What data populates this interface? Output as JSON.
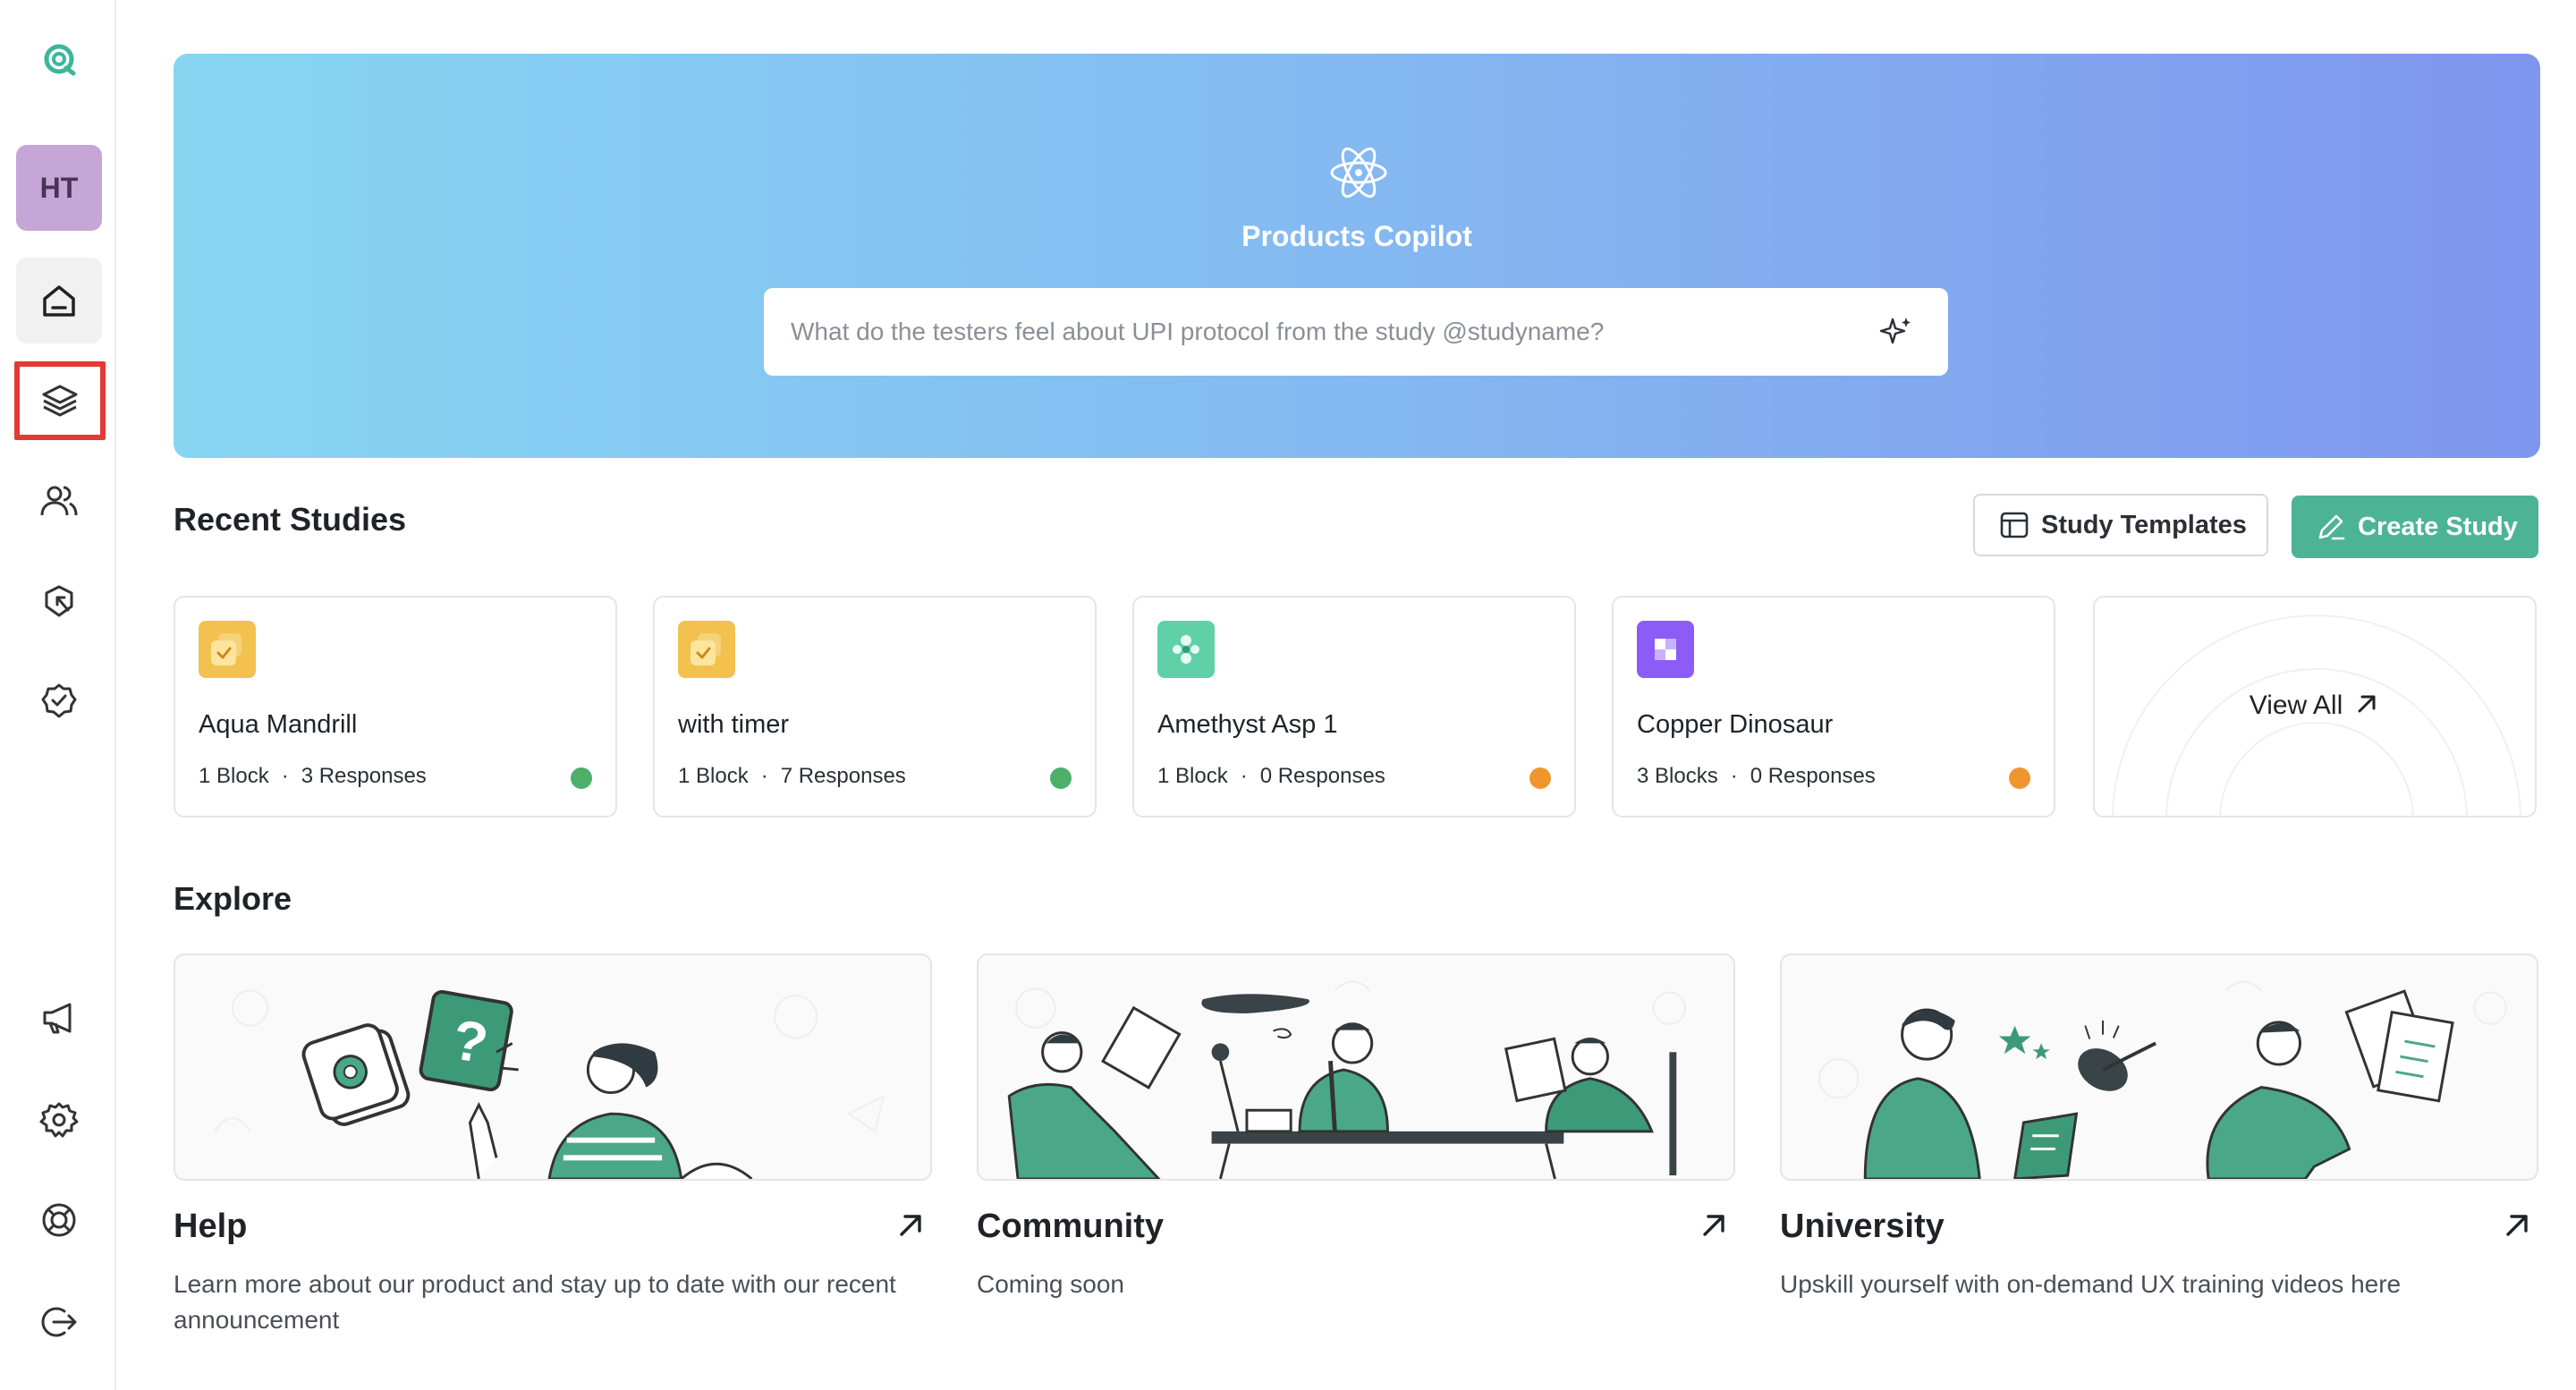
{
  "sidebar": {
    "avatar_initials": "HT",
    "items": [
      {
        "icon": "logo-icon"
      },
      {
        "icon": "home-icon"
      },
      {
        "icon": "layers-icon"
      },
      {
        "icon": "people-icon"
      },
      {
        "icon": "cursor-click-icon"
      },
      {
        "icon": "check-badge-icon"
      },
      {
        "icon": "megaphone-icon"
      },
      {
        "icon": "gear-icon"
      },
      {
        "icon": "lifebuoy-icon"
      },
      {
        "icon": "logout-icon"
      }
    ],
    "highlight_color": "#e53935"
  },
  "hero": {
    "title": "Products Copilot",
    "search_placeholder": "What do the testers feel about UPI protocol from the study @studyname?",
    "gradient": [
      "#86d6f2",
      "#7f96ee"
    ]
  },
  "recent": {
    "title": "Recent Studies",
    "templates_button": "Study Templates",
    "create_button": "Create Study",
    "studies": [
      {
        "name": "Aqua Mandrill",
        "blocks": "1 Block",
        "responses": "3 Responses",
        "status_color": "#4caf6a",
        "icon_color": "#f2c14e"
      },
      {
        "name": "with timer",
        "blocks": "1 Block",
        "responses": "7 Responses",
        "status_color": "#4caf6a",
        "icon_color": "#f2c14e"
      },
      {
        "name": "Amethyst Asp 1",
        "blocks": "1 Block",
        "responses": "0 Responses",
        "status_color": "#f0952e",
        "icon_color": "#5fd0a8"
      },
      {
        "name": "Copper Dinosaur",
        "blocks": "3 Blocks",
        "responses": "0 Responses",
        "status_color": "#f0952e",
        "icon_color": "#8b5cf6"
      }
    ],
    "view_all": "View All"
  },
  "explore": {
    "title": "Explore",
    "cards": [
      {
        "title": "Help",
        "description": "Learn more about our product and stay up to date with our recent announcement"
      },
      {
        "title": "Community",
        "description": "Coming soon"
      },
      {
        "title": "University",
        "description": "Upskill yourself with on-demand UX training videos here"
      }
    ]
  },
  "colors": {
    "accent": "#4cb494",
    "illustration_green": "#4aa888"
  }
}
